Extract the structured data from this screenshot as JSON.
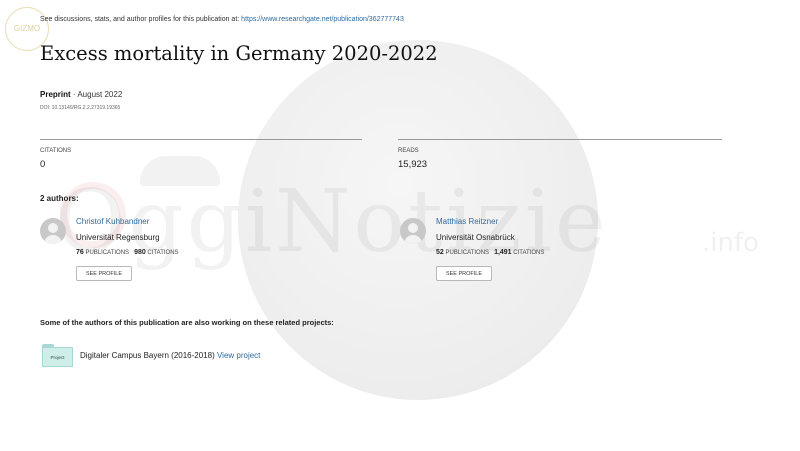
{
  "header": {
    "prefix": "See discussions, stats, and author profiles for this publication at: ",
    "url": "https://www.researchgate.net/publication/362777743"
  },
  "badge_text": "GIZMO",
  "title": "Excess mortality in Germany 2020-2022",
  "meta": {
    "type": "Preprint",
    "date": " · August 2022",
    "doi": "DOI: 10.13140/RG.2.2.27319.19365"
  },
  "stats": {
    "citations_label": "CITATIONS",
    "citations_value": "0",
    "reads_label": "READS",
    "reads_value": "15,923"
  },
  "authors_heading": "2 authors:",
  "authors": [
    {
      "name": "Christof Kuhbandner",
      "institution": "Universität Regensburg",
      "publications_count": "76",
      "publications_label": "PUBLICATIONS",
      "citations_count": "980",
      "citations_label": "CITATIONS",
      "button": "SEE PROFILE"
    },
    {
      "name": "Matthias Reitzner",
      "institution": "Universität Osnabrück",
      "publications_count": "52",
      "publications_label": "PUBLICATIONS",
      "citations_count": "1,491",
      "citations_label": "CITATIONS",
      "button": "SEE PROFILE"
    }
  ],
  "related_heading": "Some of the authors of this publication are also working on these related projects:",
  "project": {
    "folder_label": "Project",
    "name": "Digitaler Campus Bayern (2016-2018) ",
    "link": "View project"
  },
  "watermark": {
    "text": "OggiNotizie",
    "suffix": ".info"
  }
}
